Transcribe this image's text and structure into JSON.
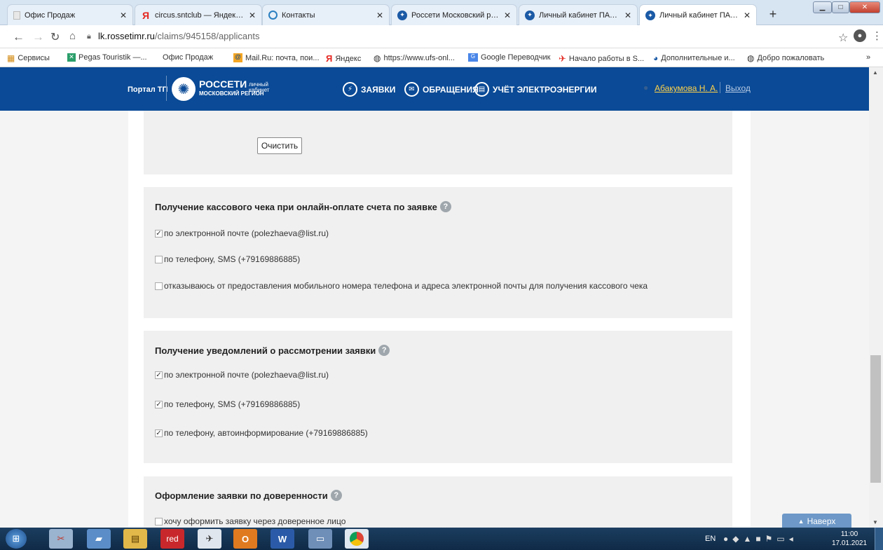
{
  "browser": {
    "tabs": [
      {
        "title": "Офис Продаж",
        "favicon": "page-icon"
      },
      {
        "title": "circus.sntclub — Яндекс: н",
        "favicon": "yandex-icon"
      },
      {
        "title": "Контакты",
        "favicon": "contacts-icon"
      },
      {
        "title": "Россети Московский реги",
        "favicon": "rosseti-icon"
      },
      {
        "title": "Личный кабинет ПАО \"Ро",
        "favicon": "rosseti-icon"
      },
      {
        "title": "Личный кабинет ПАО \"Ро",
        "favicon": "rosseti-icon"
      }
    ],
    "url_host": "lk.rossetimr.ru",
    "url_path": "/claims/945158/applicants",
    "bookmarks": [
      "Сервисы",
      "Pegas Touristik —...",
      "Офис Продаж",
      "Mail.Ru: почта, пои...",
      "Яндекс",
      "https://www.ufs-onl...",
      "Google Переводчик",
      "Начало работы в S...",
      "Дополнительные и...",
      "Добро пожаловать"
    ],
    "bookmarks_more": "»"
  },
  "header": {
    "portal": "Портал ТП",
    "brand": "РОССЕТИ",
    "brand_sub": "МОСКОВСКИЙ РЕГИОН",
    "cabinet_1": "личный",
    "cabinet_2": "кабинет",
    "nav": [
      "ЗАЯВКИ",
      "ОБРАЩЕНИЯ",
      "УЧЁТ ЭЛЕКТРОЭНЕРГИИ"
    ],
    "user": "Абакумова Н. А.",
    "logout": "Выход"
  },
  "clear_button": "Очистить",
  "receipt": {
    "title": "Получение кассового чека при онлайн-оплате счета по заявке",
    "options": [
      {
        "label": "по электронной почте (polezhaeva@list.ru)",
        "checked": true
      },
      {
        "label": "по телефону, SMS (+79169886885)",
        "checked": false
      },
      {
        "label": "отказываюсь от предоставления мобильного номера телефона и адреса электронной почты для получения кассового чека",
        "checked": false
      }
    ]
  },
  "notifications": {
    "title": "Получение уведомлений о рассмотрении заявки",
    "options": [
      {
        "label": "по электронной почте (polezhaeva@list.ru)",
        "checked": true
      },
      {
        "label": "по телефону, SMS (+79169886885)",
        "checked": true
      },
      {
        "label": "по телефону, автоинформирование (+79169886885)",
        "checked": true
      }
    ]
  },
  "proxy": {
    "title": "Оформление заявки по доверенности",
    "option": {
      "label": "хочу оформить заявку через доверенное лицо",
      "checked": false
    }
  },
  "back_to_top": "Наверх",
  "taskbar": {
    "lang": "EN",
    "time": "11:00",
    "date": "17.01.2021",
    "red_label": "red"
  },
  "colors": {
    "header_bg": "#0a4a96",
    "accent": "#6d98c7"
  }
}
